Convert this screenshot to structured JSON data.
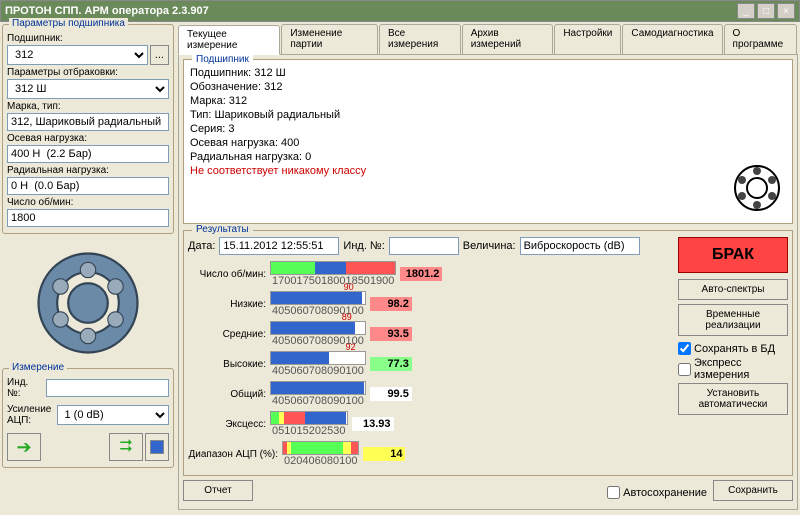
{
  "window": {
    "title": "ПРОТОН СПП. АРМ оператора 2.3.907"
  },
  "sidebar": {
    "params_title": "Параметры подшипника",
    "bearing_label": "Подшипник:",
    "bearing_value": "312",
    "reject_label": "Параметры отбраковки:",
    "reject_value": "312 Ш",
    "brand_label": "Марка, тип:",
    "brand_value": "312, Шариковый радиальный",
    "axial_label": "Осевая нагрузка:",
    "axial_value": "400 Н  (2.2 Бар)",
    "radial_label": "Радиальная нагрузка:",
    "radial_value": "0 Н  (0.0 Бар)",
    "rpm_label": "Число об/мин:",
    "rpm_value": "1800",
    "meas_title": "Измерение",
    "ind_label": "Инд. №:",
    "gain_label": "Усиление АЦП:",
    "gain_value": "1 (0 dB)"
  },
  "tabs": [
    "Текущее измерение",
    "Изменение партии",
    "Все измерения",
    "Архив измерений",
    "Настройки",
    "Самодиагностика",
    "О программе"
  ],
  "info": {
    "title": "Подшипник",
    "lines": {
      "l1": "Подшипник: 312 Ш",
      "l2": "Обозначение: 312",
      "l3": "Марка: 312",
      "l4": "Тип: Шариковый радиальный",
      "l5": "Серия: 3",
      "l6": "Осевая нагрузка: 400",
      "l7": "Радиальная нагрузка: 0",
      "l8": "Не соответствует никакому классу"
    }
  },
  "results": {
    "title": "Результаты",
    "date_label": "Дата:",
    "date_value": "15.11.2012 12:55:51",
    "ind_label": "Инд. №:",
    "val_label": "Величина:",
    "val_value": "Виброскорость (dB)",
    "verdict": "БРАК",
    "btn_auto": "Авто-спектры",
    "btn_time": "Временные реализации",
    "chk_save": "Сохранять в БД",
    "chk_express": "Экспресс измерения",
    "btn_set": "Установить автоматически",
    "btn_report": "Отчет",
    "chk_autosave": "Автосохранение",
    "btn_save": "Сохранить",
    "rows": {
      "r1": {
        "label": "Число об/мин:",
        "value": "1801.2",
        "ticks": [
          "1700",
          "1750",
          "1800",
          "1850",
          "1900"
        ]
      },
      "r2": {
        "label": "Низкие:",
        "value": "98.2",
        "pk": "90",
        "ticks": [
          "40",
          "50",
          "60",
          "70",
          "80",
          "90",
          "100"
        ]
      },
      "r3": {
        "label": "Средние:",
        "value": "93.5",
        "pk": "89",
        "ticks": [
          "40",
          "50",
          "60",
          "70",
          "80",
          "90",
          "100"
        ]
      },
      "r4": {
        "label": "Высокие:",
        "value": "77.3",
        "pk": "92",
        "ticks": [
          "40",
          "50",
          "60",
          "70",
          "80",
          "90",
          "100"
        ]
      },
      "r5": {
        "label": "Общий:",
        "value": "99.5",
        "ticks": [
          "40",
          "50",
          "60",
          "70",
          "80",
          "90",
          "100"
        ]
      },
      "r6": {
        "label": "Эксцесс:",
        "value": "13.93",
        "ticks": [
          "0",
          "5",
          "10",
          "15",
          "20",
          "25",
          "30"
        ]
      },
      "r7": {
        "label": "Диапазон АЦП (%):",
        "value": "14",
        "ticks": [
          "0",
          "20",
          "40",
          "60",
          "80",
          "100"
        ]
      }
    }
  }
}
